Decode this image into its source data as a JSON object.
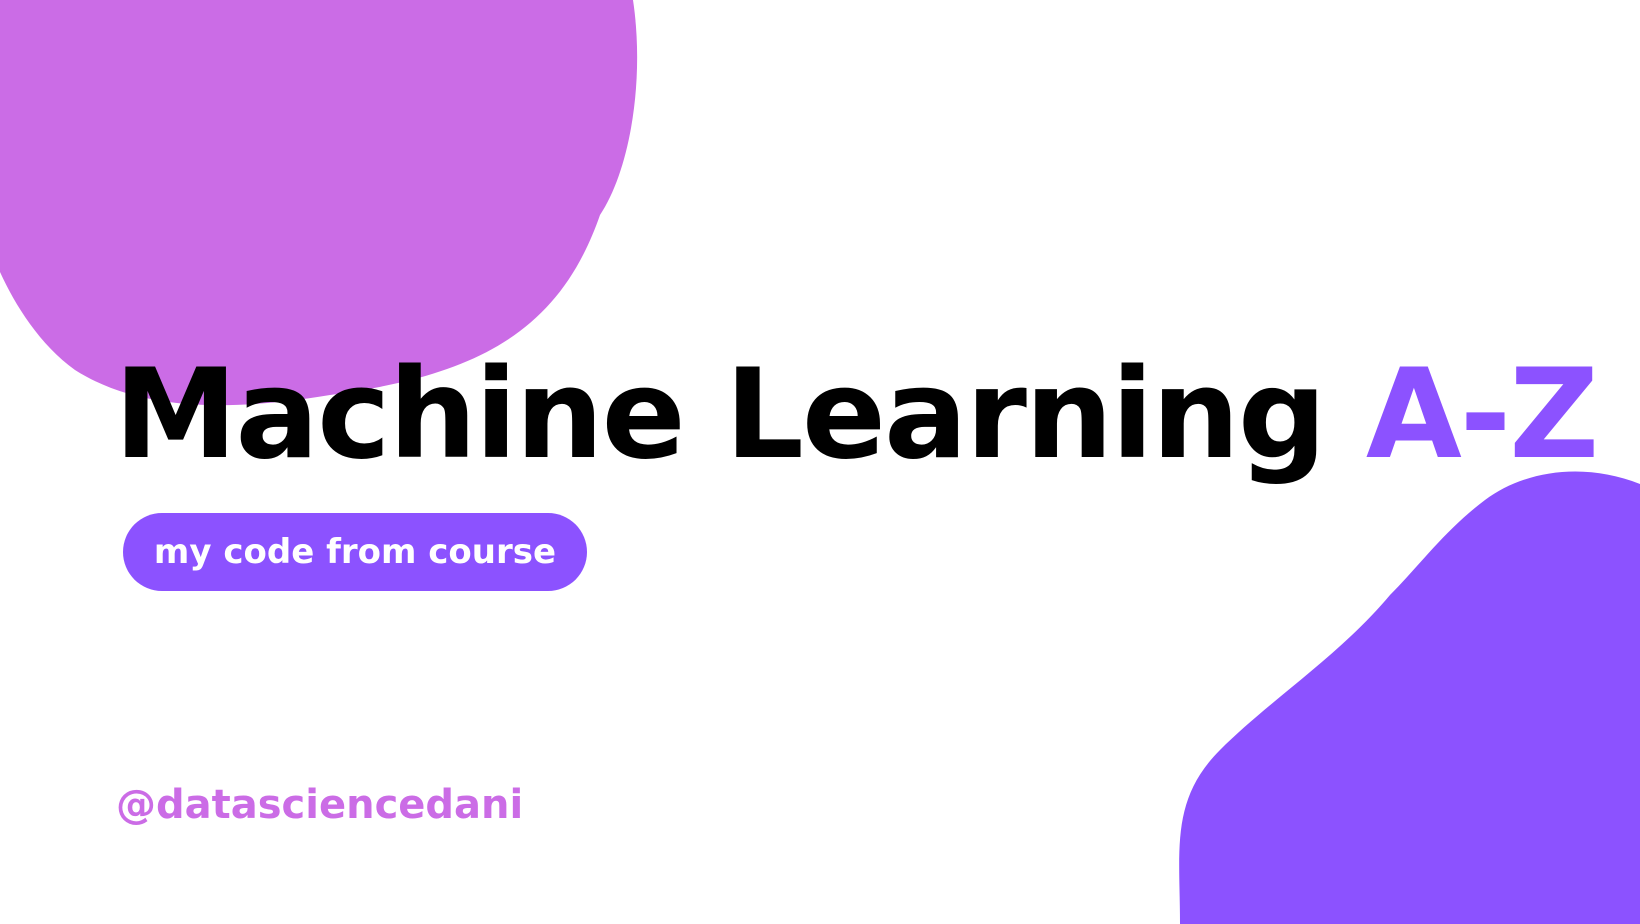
{
  "colors": {
    "blob_top_left": "#cb6ce6",
    "blob_bottom_right": "#8c52ff",
    "title_text": "#000000",
    "title_accent": "#8c52ff",
    "pill_background": "#8c52ff",
    "pill_text": "#ffffff",
    "handle_text": "#cb6ce6",
    "background": "#ffffff"
  },
  "title": {
    "main": "Machine Learning ",
    "accent": "A-Z"
  },
  "subtitle_pill": {
    "label": "my code from course"
  },
  "handle": {
    "text": "@datasciencedani"
  }
}
